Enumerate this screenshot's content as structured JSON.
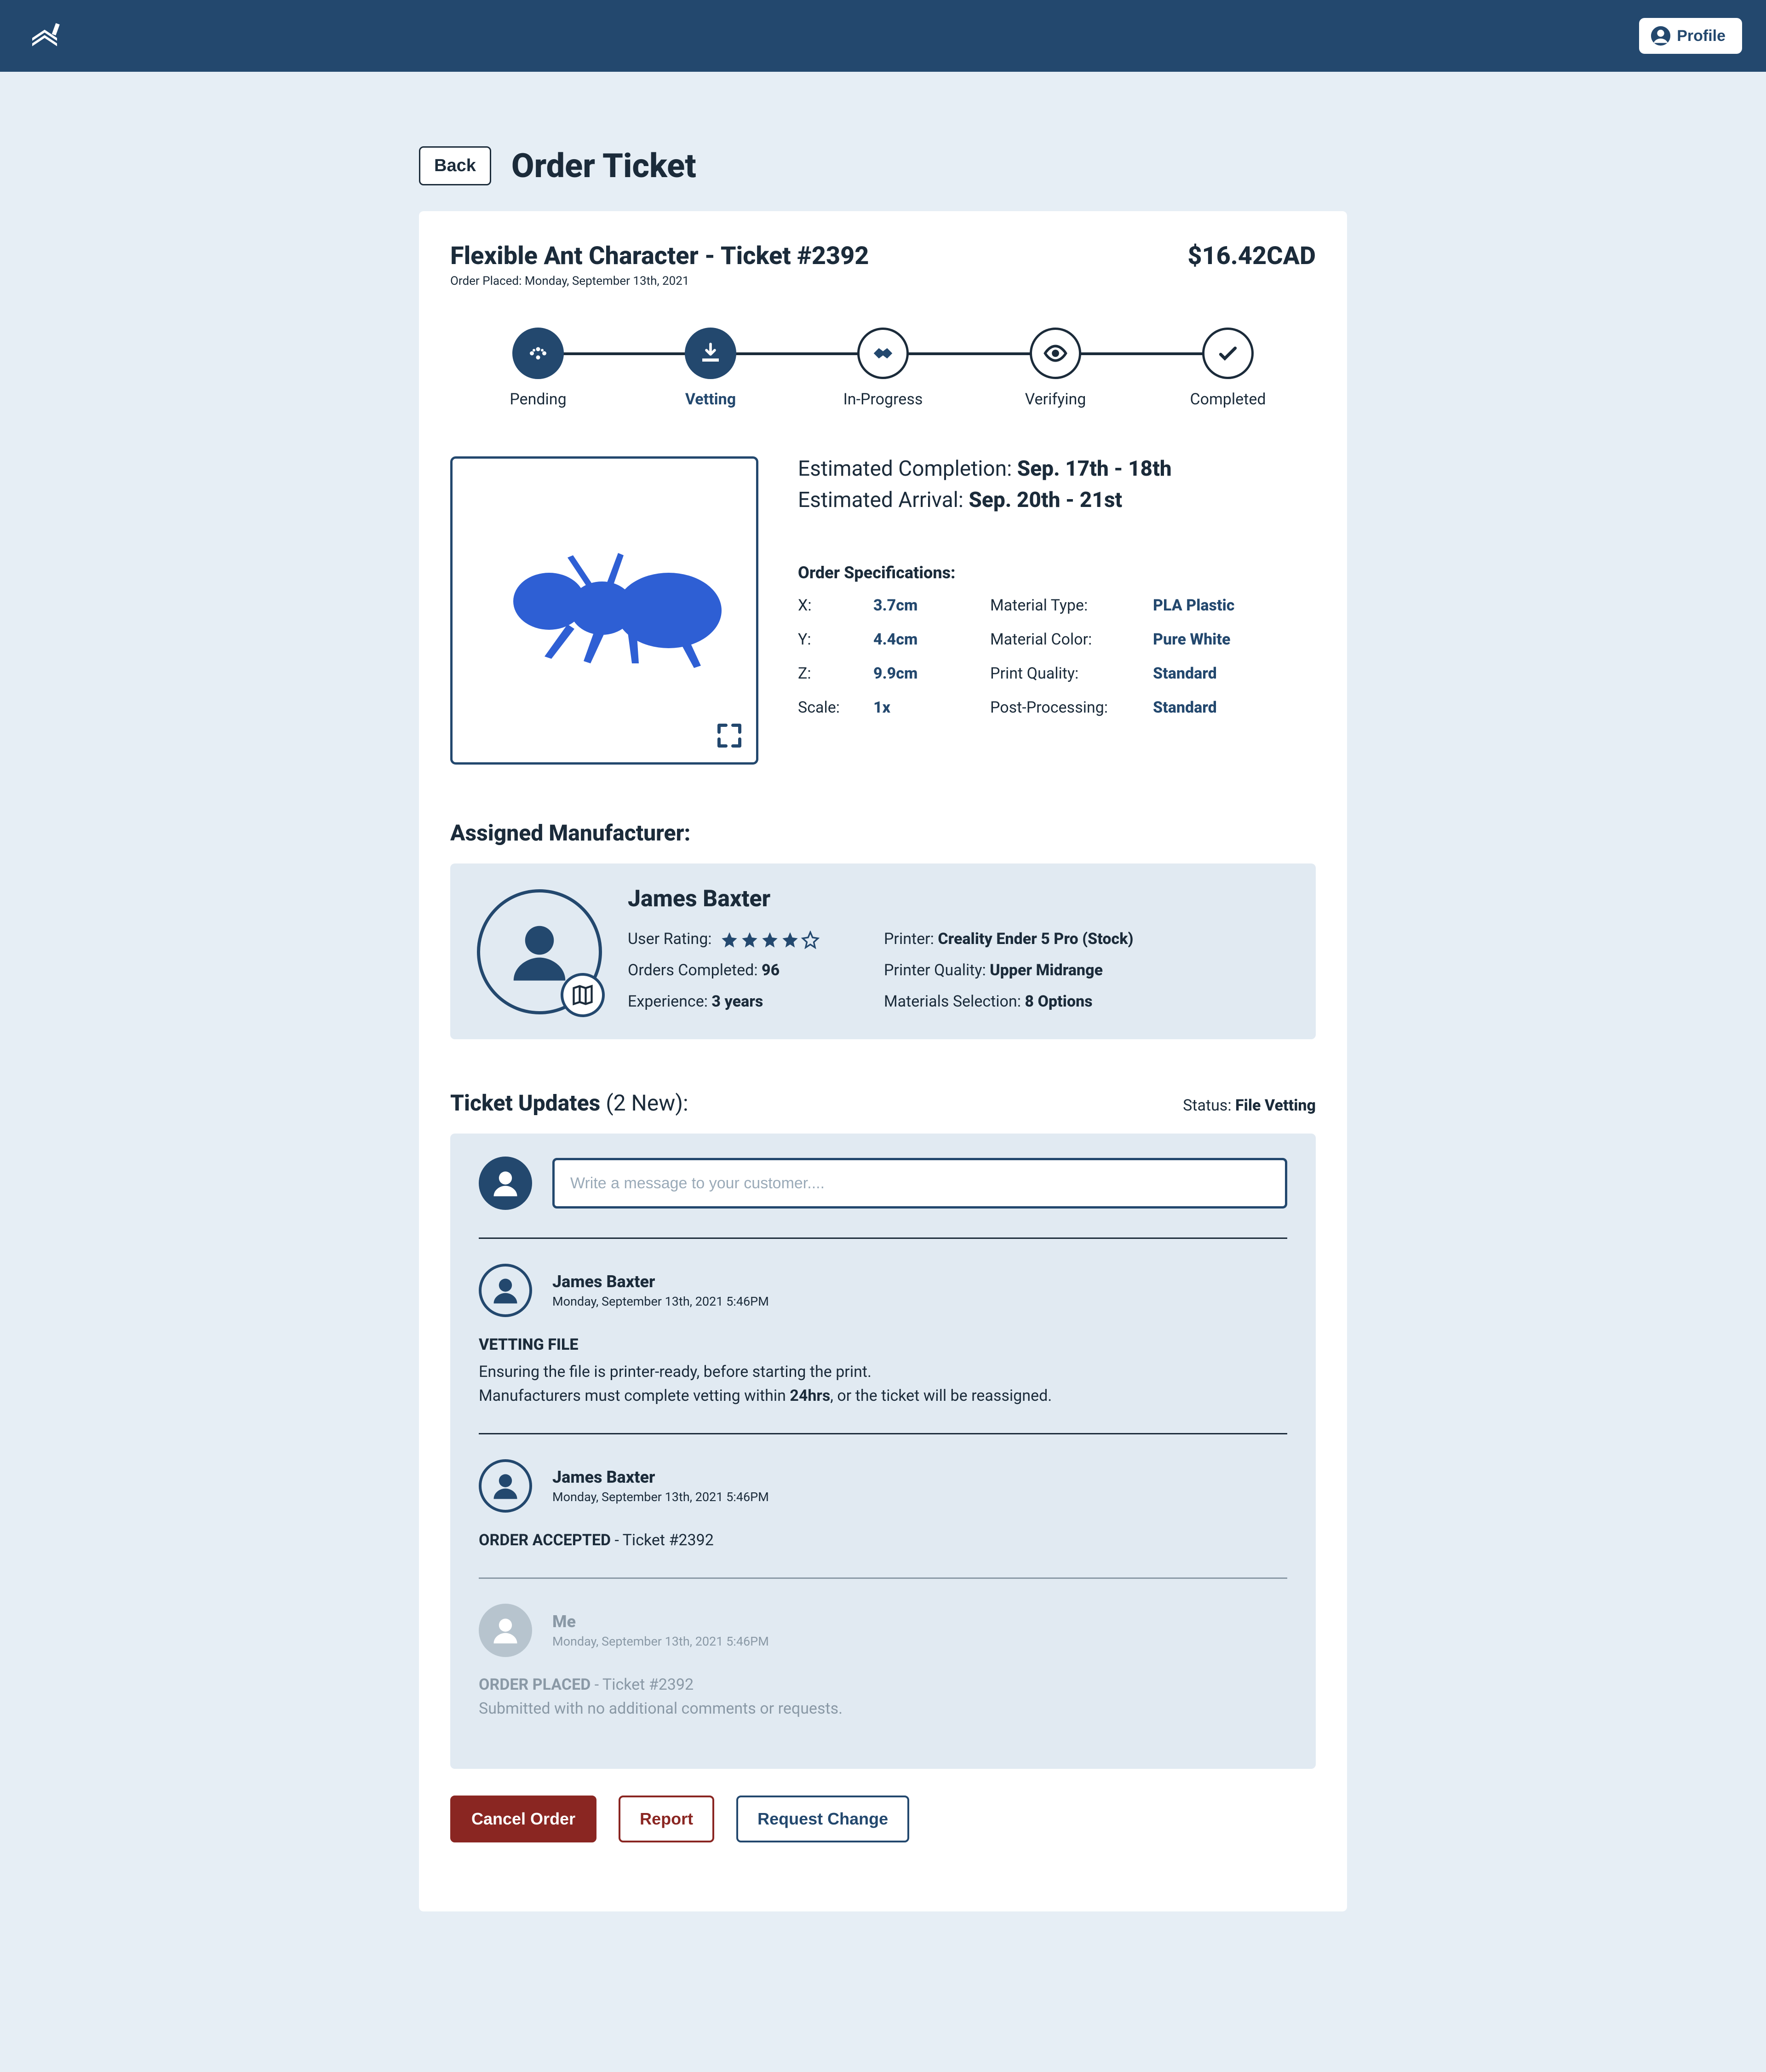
{
  "header": {
    "profile_label": "Profile"
  },
  "page": {
    "back_label": "Back",
    "title": "Order Ticket"
  },
  "ticket": {
    "title": "Flexible Ant Character - Ticket #2392",
    "placed_line": "Order Placed: Monday, September 13th, 2021",
    "price": "$16.42CAD"
  },
  "steps": [
    {
      "label": "Pending",
      "state": "done",
      "icon": "dots"
    },
    {
      "label": "Vetting",
      "state": "active",
      "icon": "download"
    },
    {
      "label": "In-Progress",
      "state": "todo",
      "icon": "handshake"
    },
    {
      "label": "Verifying",
      "state": "todo",
      "icon": "eye"
    },
    {
      "label": "Completed",
      "state": "todo",
      "icon": "check"
    }
  ],
  "estimates": {
    "completion_label": "Estimated Completion: ",
    "completion_value": "Sep. 17th - 18th",
    "arrival_label": "Estimated Arrival: ",
    "arrival_value": "Sep. 20th - 21st"
  },
  "specs": {
    "title": "Order Specifications:",
    "rows": {
      "x_label": "X:",
      "x_val": "3.7cm",
      "y_label": "Y:",
      "y_val": "4.4cm",
      "z_label": "Z:",
      "z_val": "9.9cm",
      "scale_label": "Scale:",
      "scale_val": "1x",
      "mat_type_label": "Material Type:",
      "mat_type_val": "PLA Plastic",
      "mat_color_label": "Material Color:",
      "mat_color_val": "Pure White",
      "quality_label": "Print Quality:",
      "quality_val": "Standard",
      "post_label": "Post-Processing:",
      "post_val": "Standard"
    }
  },
  "manufacturer": {
    "section_title": "Assigned Manufacturer:",
    "name": "James Baxter",
    "rating_label": "User Rating:",
    "rating_stars": 4,
    "orders_label": "Orders Completed: ",
    "orders_val": "96",
    "exp_label": "Experience: ",
    "exp_val": "3 years",
    "printer_label": "Printer: ",
    "printer_val": "Creality Ender 5 Pro (Stock)",
    "pquality_label": "Printer Quality: ",
    "pquality_val": "Upper Midrange",
    "materials_label": "Materials Selection: ",
    "materials_val": "8 Options"
  },
  "updates": {
    "title": "Ticket Updates ",
    "count": "(2 New):",
    "status_label": "Status: ",
    "status_val": "File Vetting",
    "input_placeholder": "Write a message to your customer....",
    "items": [
      {
        "author": "James Baxter",
        "time": "Monday, September 13th, 2021 5:46PM",
        "title": "VETTING FILE",
        "line1": "Ensuring the file is printer-ready, before starting the print.",
        "line2_pre": "Manufacturers must complete vetting within ",
        "line2_bold": "24hrs",
        "line2_post": ", or the ticket will be reassigned.",
        "muted": false
      },
      {
        "author": "James Baxter",
        "time": "Monday, September 13th, 2021 5:46PM",
        "title": "ORDER ACCEPTED",
        "suffix": " - Ticket #2392",
        "muted": false
      },
      {
        "author": "Me",
        "time": "Monday, September 13th, 2021 5:46PM",
        "title": "ORDER PLACED",
        "suffix": " - Ticket #2392",
        "line1": "Submitted with no additional comments or requests.",
        "muted": true
      }
    ]
  },
  "actions": {
    "cancel": "Cancel Order",
    "report": "Report",
    "request_change": "Request Change"
  }
}
